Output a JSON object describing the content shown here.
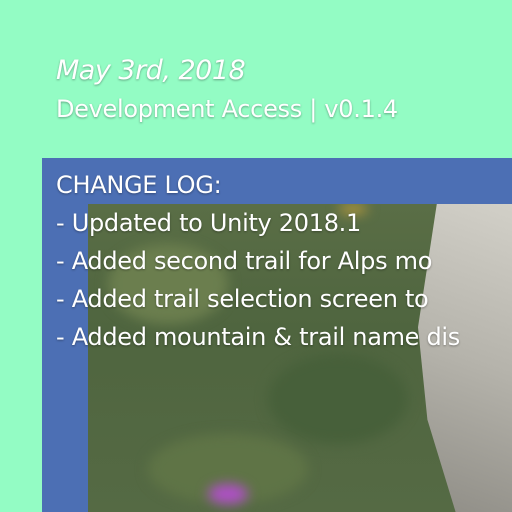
{
  "update_note": {
    "date": "May 3rd, 2018",
    "subtitle": "Development Access | v0.1.4",
    "changelog_heading": "CHANGE LOG:",
    "items": [
      "- Updated to Unity 2018.1",
      "- Added second trail for Alps mo",
      "- Added trail selection screen to",
      "- Added mountain & trail name dis"
    ]
  },
  "colors": {
    "background": "#93fcc4",
    "frame": "#4c6fb4",
    "text": "#ffffff"
  }
}
